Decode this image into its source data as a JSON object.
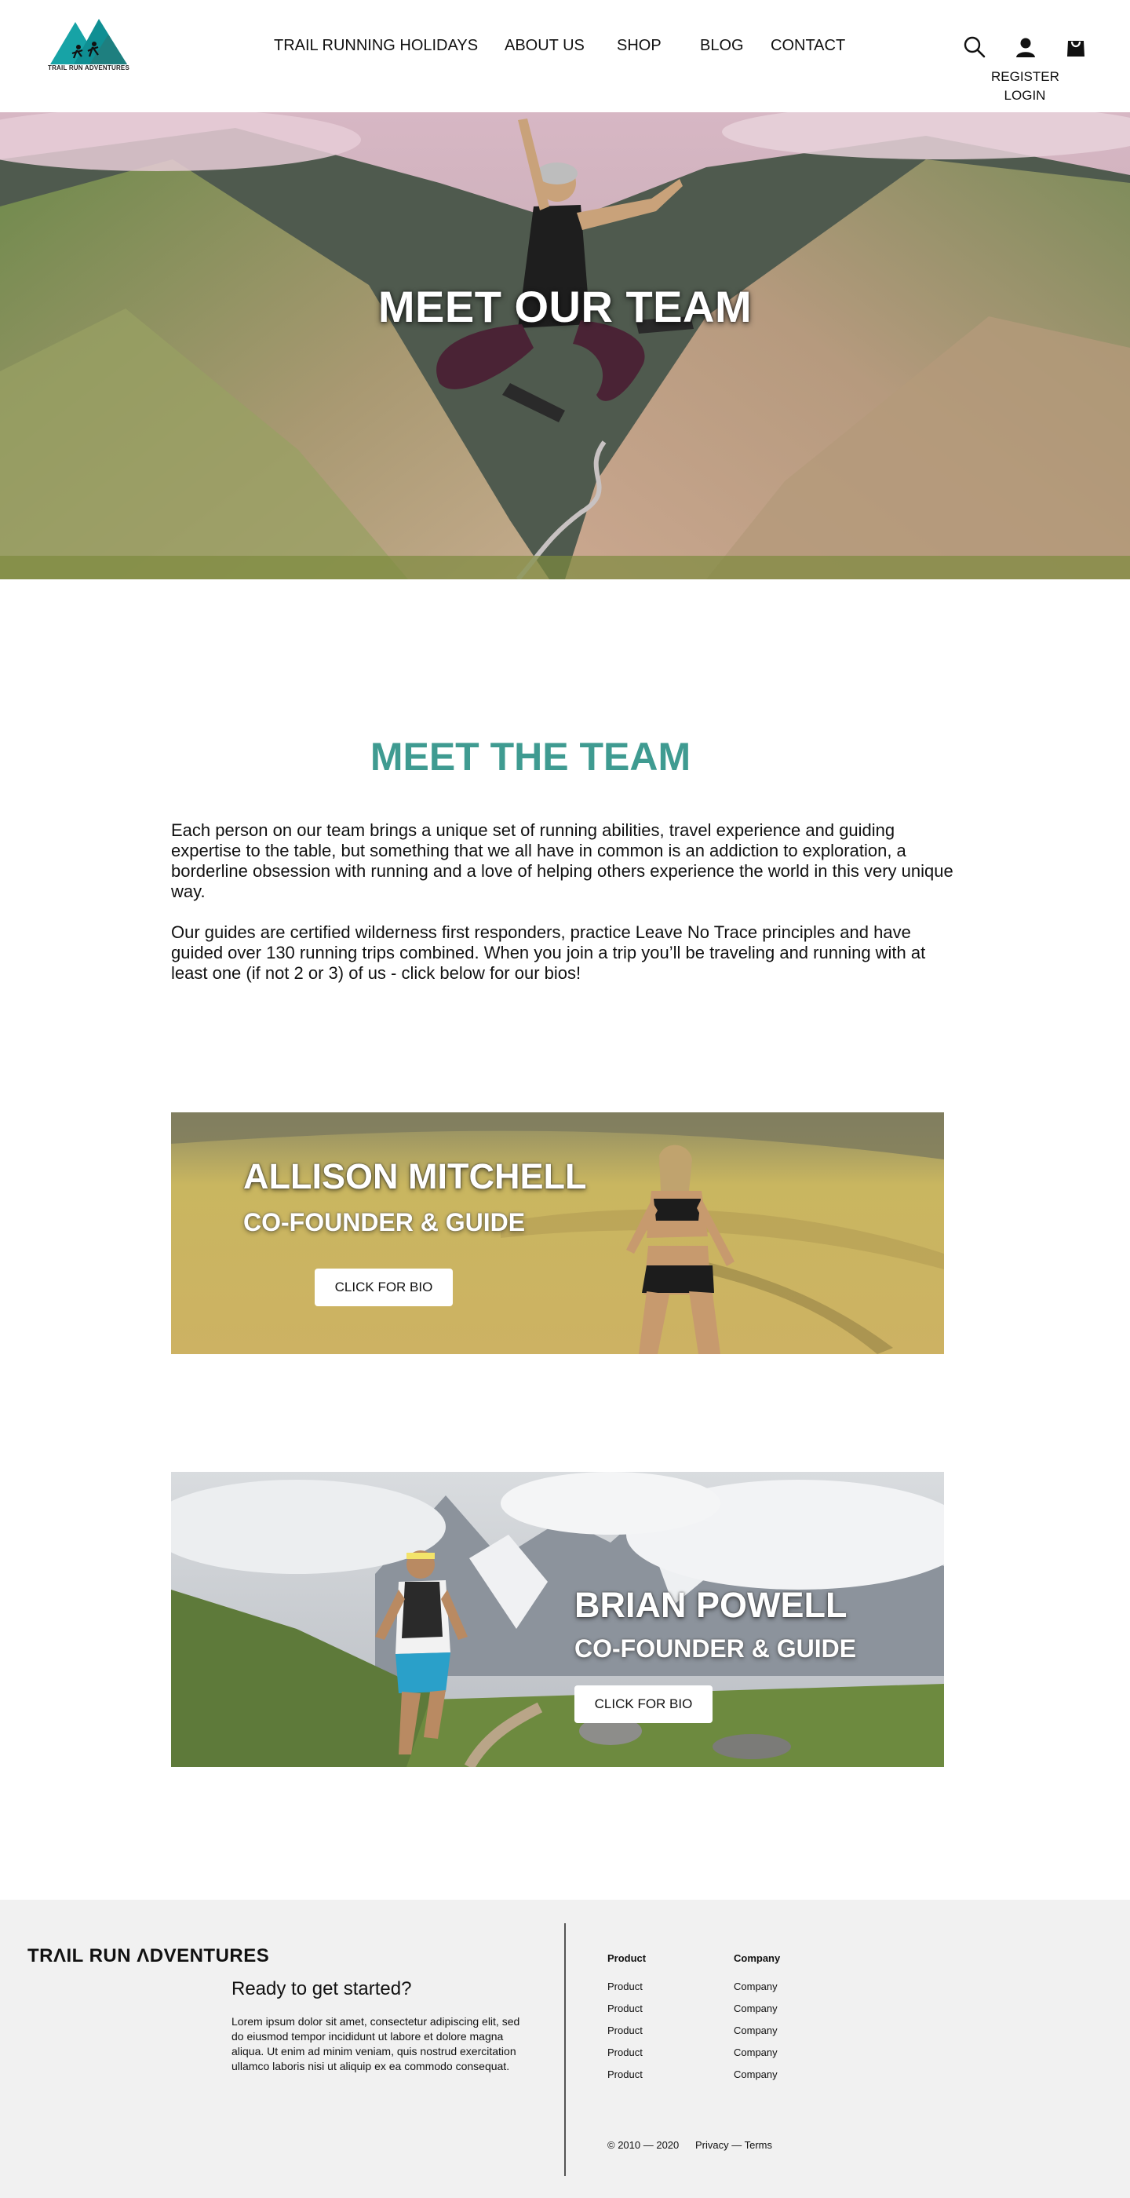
{
  "header": {
    "logo_text": "TRAIL RUN ADVENTURES",
    "nav": [
      {
        "label": "TRAIL RUNNING HOLIDAYS"
      },
      {
        "label": "ABOUT US"
      },
      {
        "label": "SHOP"
      },
      {
        "label": "BLOG"
      },
      {
        "label": "CONTACT"
      }
    ],
    "icons": [
      "search-icon",
      "user-icon",
      "shopping-bag-icon"
    ],
    "register": "REGISTER",
    "login": "LOGIN"
  },
  "hero": {
    "title": "MEET OUR TEAM"
  },
  "intro": {
    "title": "MEET THE TEAM",
    "paragraphs": [
      "Each person on our team brings a unique set of running abilities, travel experience and guiding expertise to the table, but something that we all have in common is an addiction to exploration, a borderline obsession with running and a love of helping others experience the world in this very unique way.",
      "Our guides are certified wilderness first responders, practice Leave No Trace principles and have guided over 130 running trips combined. When you join a trip you’ll be traveling and running with at least one (if not 2 or 3) of us - click below for our bios!"
    ]
  },
  "team": [
    {
      "name": "ALLISON MITCHELL",
      "role": "CO-FOUNDER & GUIDE",
      "button": "CLICK FOR BIO"
    },
    {
      "name": "BRIAN POWELL",
      "role": "CO-FOUNDER & GUIDE",
      "button": "CLICK FOR BIO"
    }
  ],
  "footer": {
    "brand": "TRΛIL RUN ΛDVENTURES",
    "heading": "Ready to get started?",
    "body": "Lorem ipsum dolor sit amet, consectetur adipiscing elit, sed do eiusmod tempor incididunt ut labore et dolore magna aliqua. Ut enim ad minim veniam, quis nostrud exercitation ullamco laboris nisi ut aliquip ex ea commodo consequat.",
    "columns": [
      {
        "heading": "Product",
        "links": [
          "Product",
          "Product",
          "Product",
          "Product",
          "Product"
        ]
      },
      {
        "heading": "Company",
        "links": [
          "Company",
          "Company",
          "Company",
          "Company",
          "Company"
        ]
      }
    ],
    "copyright": "© 2010 — 2020",
    "legal": "Privacy — Terms"
  },
  "colors": {
    "accent": "#3f9b91",
    "footer_bg": "#f1f1f1",
    "logo_teal": "#1aa6a8"
  }
}
